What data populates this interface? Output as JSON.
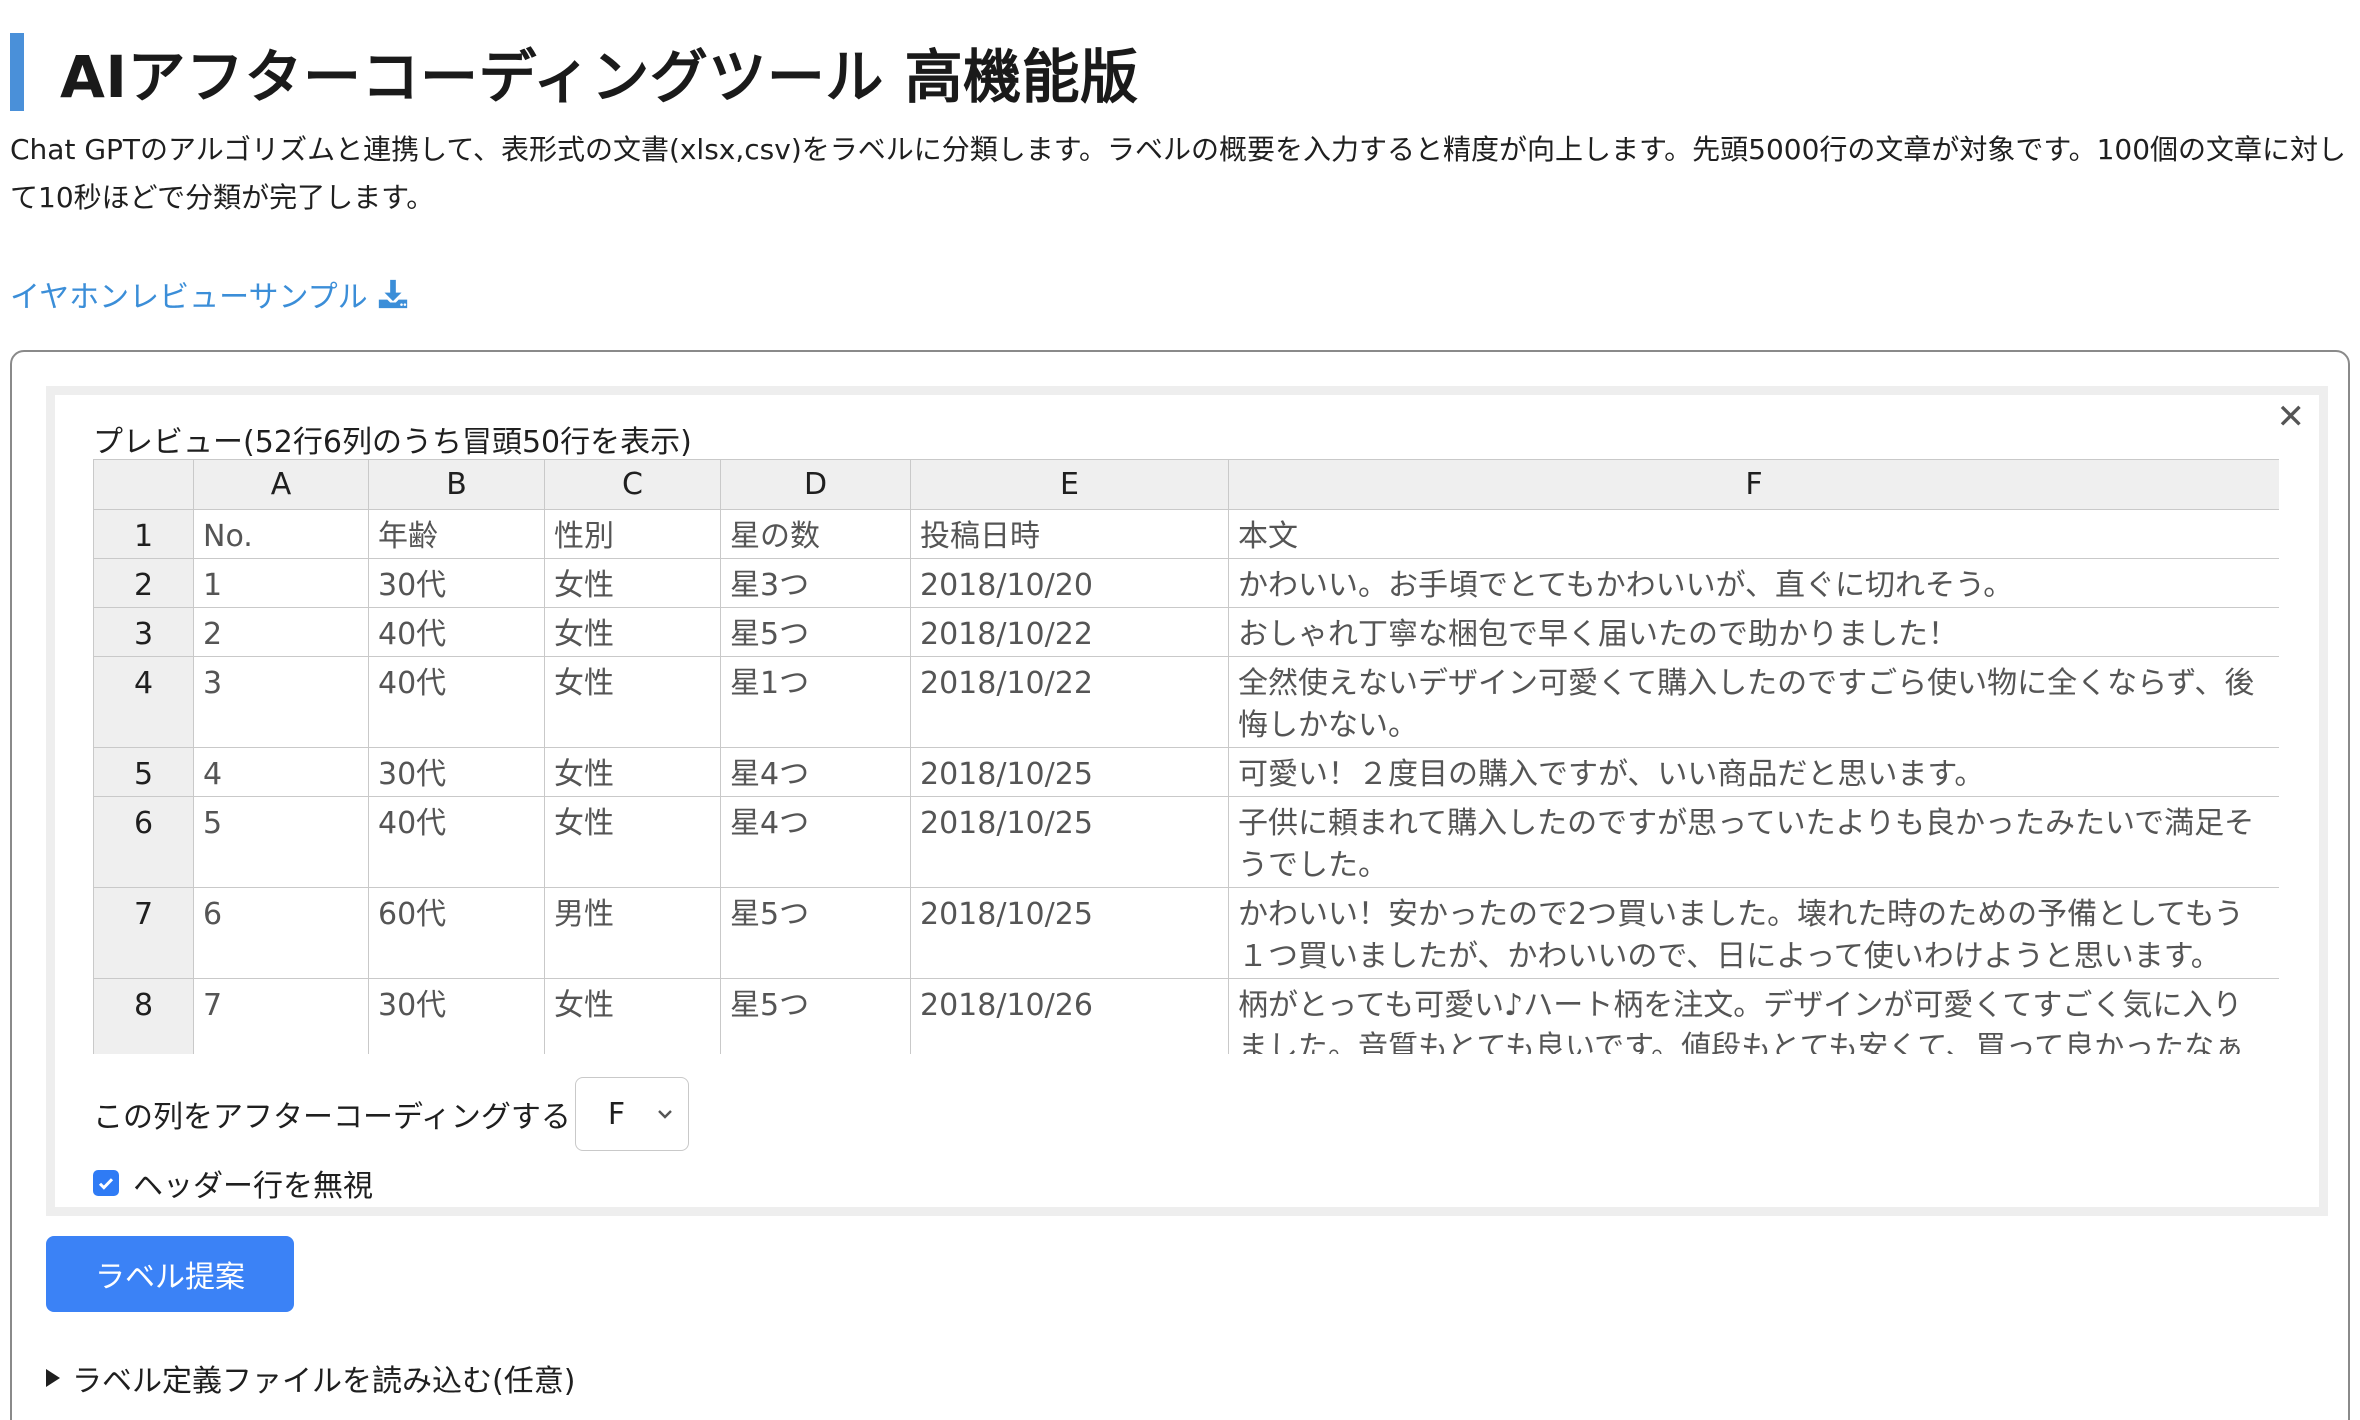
{
  "header": {
    "title": "AIアフターコーディングツール 高機能版",
    "description": "Chat GPTのアルゴリズムと連携して、表形式の文書(xlsx,csv)をラベルに分類します。ラベルの概要を入力すると精度が向上します。先頭5000行の文章が対象です。100個の文章に対して10秒ほどで分類が完了します。",
    "sample_link": "イヤホンレビューサンプル"
  },
  "colors": {
    "accent": "#4a90d9",
    "link": "#3b8ed8",
    "button": "#3b82f6"
  },
  "preview": {
    "caption": "プレビュー(52行6列のうち冒頭50行を表示)",
    "columns": [
      "A",
      "B",
      "C",
      "D",
      "E",
      "F"
    ],
    "rows": [
      {
        "num": "1",
        "cells": [
          "No.",
          "年齢",
          "性別",
          "星の数",
          "投稿日時",
          "本文"
        ]
      },
      {
        "num": "2",
        "cells": [
          "1",
          "30代",
          "女性",
          "星3つ",
          "2018/10/20",
          "かわいい。お手頃でとてもかわいいが、直ぐに切れそう。"
        ]
      },
      {
        "num": "3",
        "cells": [
          "2",
          "40代",
          "女性",
          "星5つ",
          "2018/10/22",
          "おしゃれ丁寧な梱包で早く届いたので助かりました！"
        ]
      },
      {
        "num": "4",
        "cells": [
          "3",
          "40代",
          "女性",
          "星1つ",
          "2018/10/22",
          "全然使えないデザイン可愛くて購入したのですごら使い物に全くならず、後悔しかない。"
        ]
      },
      {
        "num": "5",
        "cells": [
          "4",
          "30代",
          "女性",
          "星4つ",
          "2018/10/25",
          "可愛い！２度目の購入ですが、いい商品だと思います。"
        ]
      },
      {
        "num": "6",
        "cells": [
          "5",
          "40代",
          "女性",
          "星4つ",
          "2018/10/25",
          "子供に頼まれて購入したのですが思っていたよりも良かったみたいで満足そうでした。"
        ]
      },
      {
        "num": "7",
        "cells": [
          "6",
          "60代",
          "男性",
          "星5つ",
          "2018/10/25",
          "かわいい！安かったので2つ買いました。壊れた時のための予備としてもう１つ買いましたが、かわいいので、日によって使いわけようと思います。"
        ]
      },
      {
        "num": "8",
        "cells": [
          "7",
          "30代",
          "女性",
          "星5つ",
          "2018/10/26",
          "柄がとっても可愛い♪ハート柄を注文。デザインが可愛くてすごく気に入りました。音質もとても良いです。値段もとても安くて、買って良かったなぁと思います。"
        ]
      }
    ],
    "column_select_label": "この列をアフターコーディングする",
    "column_select_value": "F",
    "ignore_header_label": "ヘッダー行を無視",
    "ignore_header_checked": true
  },
  "actions": {
    "label_button": "ラベル提案",
    "label_file_summary": "ラベル定義ファイルを読み込む(任意)"
  }
}
